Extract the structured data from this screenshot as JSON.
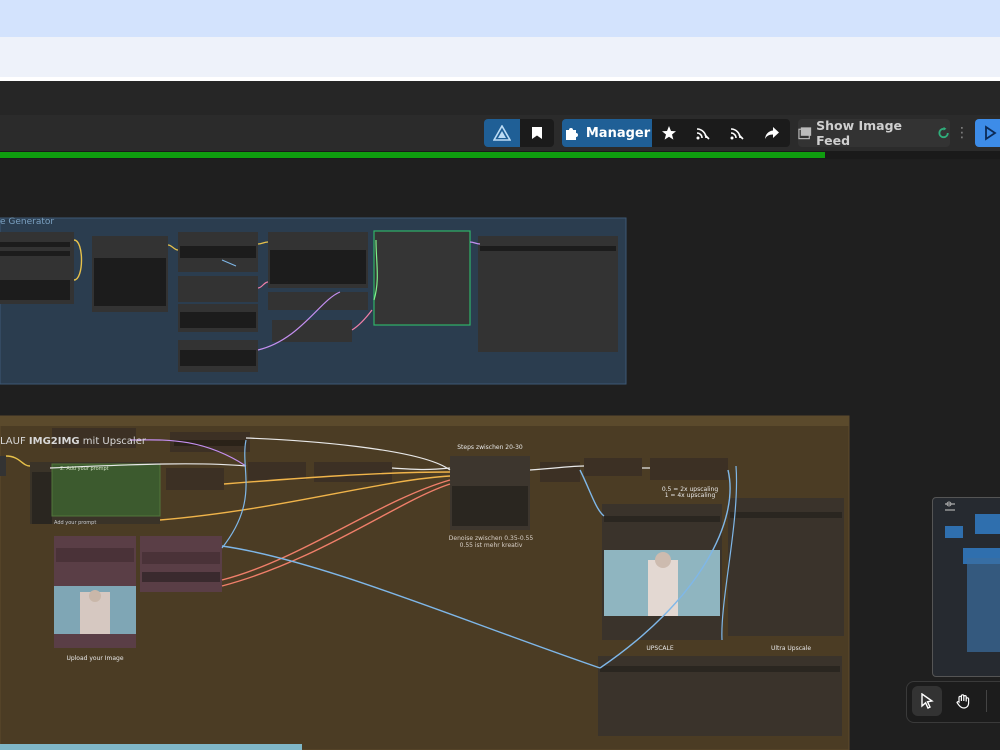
{
  "toolbar": {
    "manager_label": "Manager",
    "show_image_feed_label": "Show Image Feed",
    "drag_handle_glyph": "⋮⋮",
    "icons": {
      "logo": "app-logo-icon",
      "bookmark": "bookmark-icon",
      "manager": "puzzle-icon",
      "star": "star-icon",
      "feed_a": "feed-icon",
      "feed_b": "feed-icon",
      "share": "share-icon",
      "image_feed": "image-icon",
      "queue": "play-icon"
    },
    "accent_color": "#1f5f96",
    "queue_color": "#3d8ce8"
  },
  "progress": {
    "fraction": 0.825,
    "color": "#0f9d0f"
  },
  "canvas": {
    "groups": [
      {
        "title": "e Generator",
        "color": "#2c3e50"
      },
      {
        "title": "LAUF IMG2IMG mit Upscaler",
        "title_prefix": "LAUF ",
        "title_bold": "IMG2IMG",
        "title_suffix": " mit Upscaler",
        "color": "#4a3b22"
      }
    ],
    "labels": {
      "steps": "Steps zwischen 20-30",
      "denoise_line1": "Denoise zwischen 0.35-0.55",
      "denoise_line2": "0.55 ist mehr kreativ",
      "upscale_line1": "0.5 = 2x upscaling",
      "upscale_line2": "1 = 4x upscaling",
      "add_prompt_green": "2. Add your prompt",
      "add_prompt_bottom": "Add your prompt",
      "upload_image": "Upload your Image",
      "upscale": "UPSCALE",
      "ultra_upscale": "Ultra Upscale"
    }
  },
  "canvas_tools": {
    "select": "cursor-icon",
    "pan": "hand-icon"
  }
}
